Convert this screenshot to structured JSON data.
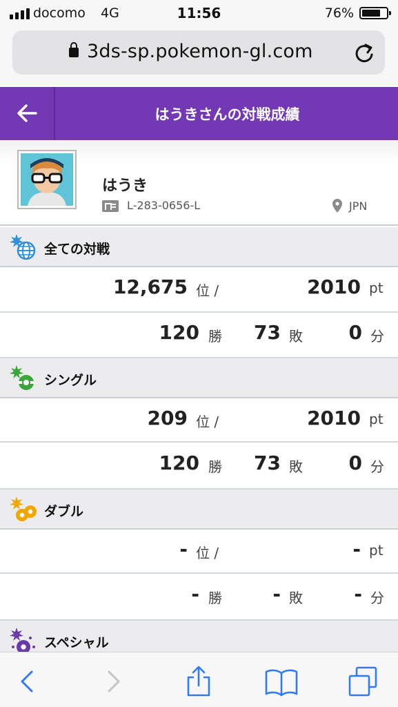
{
  "status_bar": {
    "carrier": "docomo",
    "network": "4G",
    "time": "11:56",
    "battery_percent": "76%",
    "battery_level": 0.76
  },
  "browser": {
    "url": "3ds-sp.pokemon-gl.com"
  },
  "header": {
    "title": "はうきさんの対戦成績"
  },
  "profile": {
    "name": "はうき",
    "id": "L-283-0656-L",
    "region": "JPN"
  },
  "sections": [
    {
      "title": "全ての対戦",
      "icon": "globe-icon",
      "accent": "#2f8fd8",
      "rank": "12,675",
      "rank_unit": "位 /",
      "rating": "2010",
      "rating_unit": "pt",
      "wins": "120",
      "wins_unit": "勝",
      "losses": "73",
      "losses_unit": "敗",
      "draws": "0",
      "draws_unit": "分"
    },
    {
      "title": "シングル",
      "icon": "single-battle-icon",
      "accent": "#3aa63a",
      "rank": "209",
      "rank_unit": "位 /",
      "rating": "2010",
      "rating_unit": "pt",
      "wins": "120",
      "wins_unit": "勝",
      "losses": "73",
      "losses_unit": "敗",
      "draws": "0",
      "draws_unit": "分"
    },
    {
      "title": "ダブル",
      "icon": "double-battle-icon",
      "accent": "#f0a800",
      "rank": "-",
      "rank_unit": "位 /",
      "rating": "-",
      "rating_unit": "pt",
      "wins": "-",
      "wins_unit": "勝",
      "losses": "-",
      "losses_unit": "敗",
      "draws": "-",
      "draws_unit": "分"
    },
    {
      "title": "スペシャル",
      "icon": "special-battle-icon",
      "accent": "#6a3aa8"
    }
  ],
  "colors": {
    "header_purple": "#7338b3",
    "ios_blue": "#2f7bf6"
  }
}
